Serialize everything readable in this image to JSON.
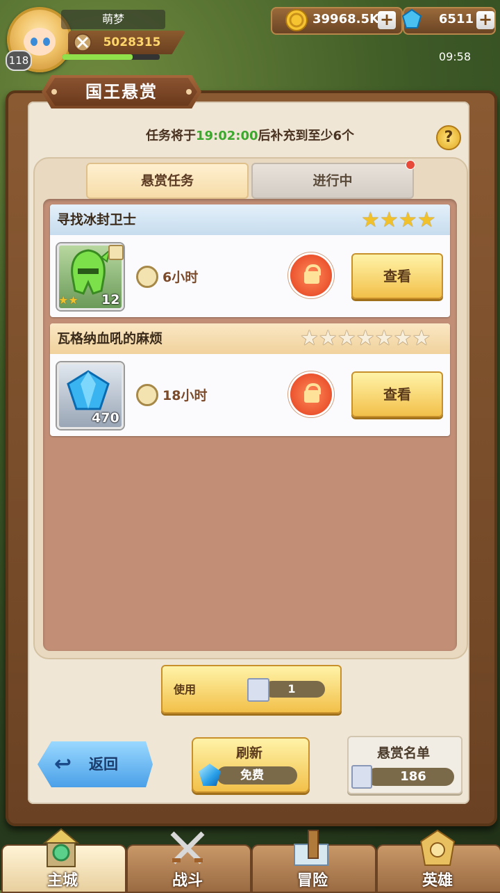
{
  "player": {
    "name": "萌梦",
    "level": "118",
    "power": "5028315",
    "exp_fraction": 0.72
  },
  "resources": {
    "gold": "39968.5K",
    "gems": "6511"
  },
  "status": {
    "time": "09:58"
  },
  "panel": {
    "title": "国王悬赏",
    "refill_prefix": "任务将于",
    "refill_time": "19:02:00",
    "refill_suffix": "后补充到至少6个",
    "help": "?"
  },
  "tabs": [
    {
      "label": "悬赏任务",
      "active": true
    },
    {
      "label": "进行中",
      "active": false,
      "has_notice": true
    }
  ],
  "tasks": [
    {
      "title": "寻找冰封卫士",
      "stars": 4,
      "max_stars": 4,
      "item": "green-helmet-icon",
      "item_stars": 2,
      "item_qty": "12",
      "duration": "6小时",
      "view_label": "查看"
    },
    {
      "title": "瓦格纳血吼的麻烦",
      "stars": 0,
      "max_stars": 7,
      "item": "blue-gem-icon",
      "item_qty": "470",
      "duration": "18小时",
      "view_label": "查看"
    }
  ],
  "use": {
    "label": "使用",
    "count": "1"
  },
  "buttons": {
    "back": "返回",
    "refresh": "刷新",
    "refresh_cost": "免费",
    "bounty_list": "悬赏名单",
    "bounty_list_count": "186"
  },
  "nav": [
    {
      "label": "主城",
      "icon": "castle-icon",
      "active": true
    },
    {
      "label": "战斗",
      "icon": "crossed-swords-icon",
      "active": false
    },
    {
      "label": "冒险",
      "icon": "map-scroll-icon",
      "active": false
    },
    {
      "label": "英雄",
      "icon": "hero-crest-icon",
      "active": false
    }
  ],
  "colors": {
    "accent_green": "#3ca82e",
    "gold_button": "#f2c04a",
    "lock_red": "#e23c1c"
  }
}
